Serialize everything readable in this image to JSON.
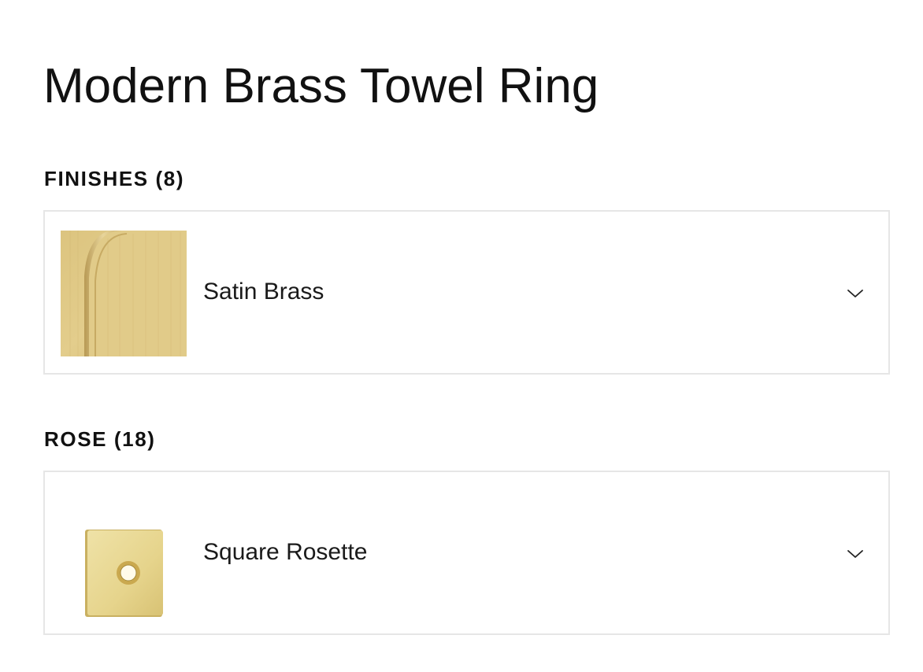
{
  "product": {
    "title": "Modern Brass Towel Ring"
  },
  "sections": {
    "finishes": {
      "heading": "FINISHES (8)",
      "selected_label": "Satin Brass",
      "swatch_icon": "satin-brass-swatch",
      "swatch_color": "#d9c07e",
      "chevron_icon": "chevron-down-icon"
    },
    "rose": {
      "heading": "ROSE (18)",
      "selected_label": "Square Rosette",
      "swatch_icon": "square-rosette-thumbnail",
      "swatch_color": "#e8d68f",
      "chevron_icon": "chevron-down-icon"
    }
  },
  "colors": {
    "border": "#e6e6e6",
    "text": "#111111"
  }
}
